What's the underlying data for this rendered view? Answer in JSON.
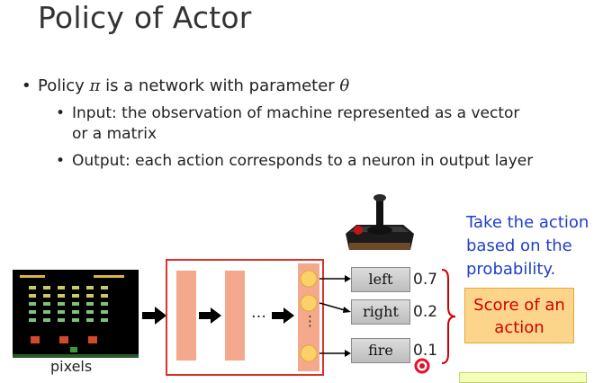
{
  "slide": {
    "title": "Policy of Actor",
    "bullet1": {
      "text_a": "Policy ",
      "pi": "π",
      "text_b": " is a network with parameter ",
      "theta": "θ"
    },
    "bullet2": "Input: the observation of machine represented as a vector or a matrix",
    "bullet3": "Output: each action corresponds to a neuron in output layer",
    "bullet_symbol": "•",
    "ellipsis": "…",
    "vdots": "⋮"
  },
  "diagram": {
    "input_label": "pixels",
    "actions": [
      {
        "label": "left",
        "prob": "0.7"
      },
      {
        "label": "right",
        "prob": "0.2"
      },
      {
        "label": "fire",
        "prob": "0.1"
      }
    ],
    "note": "Take the action based on the probability.",
    "note_lines": [
      "Take the action",
      "based on the",
      "probability."
    ],
    "score_label_lines": [
      "Score of an",
      "action"
    ]
  },
  "colors": {
    "network_border": "#d8342b",
    "layer_fill": "#f4a98c",
    "neuron_fill": "#fbd26a",
    "arrow": "#000000",
    "brace": "#d10000",
    "note_text": "#1f3fc8",
    "score_text": "#d10000",
    "score_fill": "#fcd58a"
  },
  "icons": [
    "joystick-icon",
    "space-invaders-screen",
    "arrow-right-icon",
    "record-indicator-icon"
  ]
}
